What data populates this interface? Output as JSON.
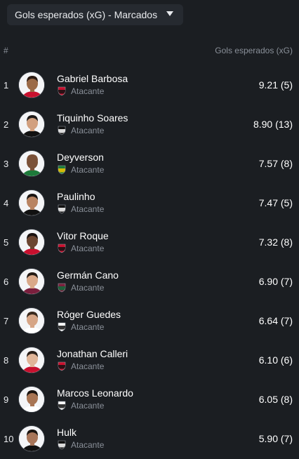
{
  "dropdown": {
    "label": "Gols esperados (xG) - Marcados",
    "icon": "caret-down-icon"
  },
  "header": {
    "rank": "#",
    "metric": "Gols esperados (xG)"
  },
  "players": [
    {
      "rank": "1",
      "name": "Gabriel Barbosa",
      "position": "Atacante",
      "value": "9.21 (5)",
      "crest": "flamengo-crest-icon",
      "crest_colors": [
        "#c8102e",
        "#111111"
      ],
      "skin": "#9b6a47",
      "hair": "#2a1a12"
    },
    {
      "rank": "2",
      "name": "Tiquinho Soares",
      "position": "Atacante",
      "value": "8.90 (13)",
      "crest": "botafogo-crest-icon",
      "crest_colors": [
        "#111111",
        "#ffffff"
      ],
      "skin": "#d2a07f",
      "hair": "#1e1a18"
    },
    {
      "rank": "3",
      "name": "Deyverson",
      "position": "Atacante",
      "value": "7.57 (8)",
      "crest": "cuiaba-crest-icon",
      "crest_colors": [
        "#1d7a3a",
        "#f5c400"
      ],
      "skin": "#7a5138",
      "hair": "#7a5138"
    },
    {
      "rank": "4",
      "name": "Paulinho",
      "position": "Atacante",
      "value": "7.47 (5)",
      "crest": "atletico-mg-crest-icon",
      "crest_colors": [
        "#111111",
        "#ffffff"
      ],
      "skin": "#b98462",
      "hair": "#1a1512"
    },
    {
      "rank": "5",
      "name": "Vitor Roque",
      "position": "Atacante",
      "value": "7.32 (8)",
      "crest": "athletico-pr-crest-icon",
      "crest_colors": [
        "#c8102e",
        "#111111"
      ],
      "skin": "#6b4530",
      "hair": "#1a1210"
    },
    {
      "rank": "6",
      "name": "Germán Cano",
      "position": "Atacante",
      "value": "6.90 (7)",
      "crest": "fluminense-crest-icon",
      "crest_colors": [
        "#7a1f3d",
        "#0e6b3a"
      ],
      "skin": "#d9a888",
      "hair": "#241a14"
    },
    {
      "rank": "7",
      "name": "Róger Guedes",
      "position": "Atacante",
      "value": "6.64 (7)",
      "crest": "corinthians-crest-icon",
      "crest_colors": [
        "#ffffff",
        "#111111"
      ],
      "skin": "#d6a586",
      "hair": "#3a2a1e"
    },
    {
      "rank": "8",
      "name": "Jonathan Calleri",
      "position": "Atacante",
      "value": "6.10 (6)",
      "crest": "sao-paulo-crest-icon",
      "crest_colors": [
        "#c8102e",
        "#111111"
      ],
      "skin": "#e0b598",
      "hair": "#2a201a"
    },
    {
      "rank": "9",
      "name": "Marcos Leonardo",
      "position": "Atacante",
      "value": "6.05 (8)",
      "crest": "santos-crest-icon",
      "crest_colors": [
        "#ffffff",
        "#111111"
      ],
      "skin": "#a87554",
      "hair": "#1a1410"
    },
    {
      "rank": "10",
      "name": "Hulk",
      "position": "Atacante",
      "value": "5.90 (7)",
      "crest": "atletico-mg-crest-icon",
      "crest_colors": [
        "#111111",
        "#ffffff"
      ],
      "skin": "#a8765a",
      "hair": "#1a1410"
    }
  ]
}
